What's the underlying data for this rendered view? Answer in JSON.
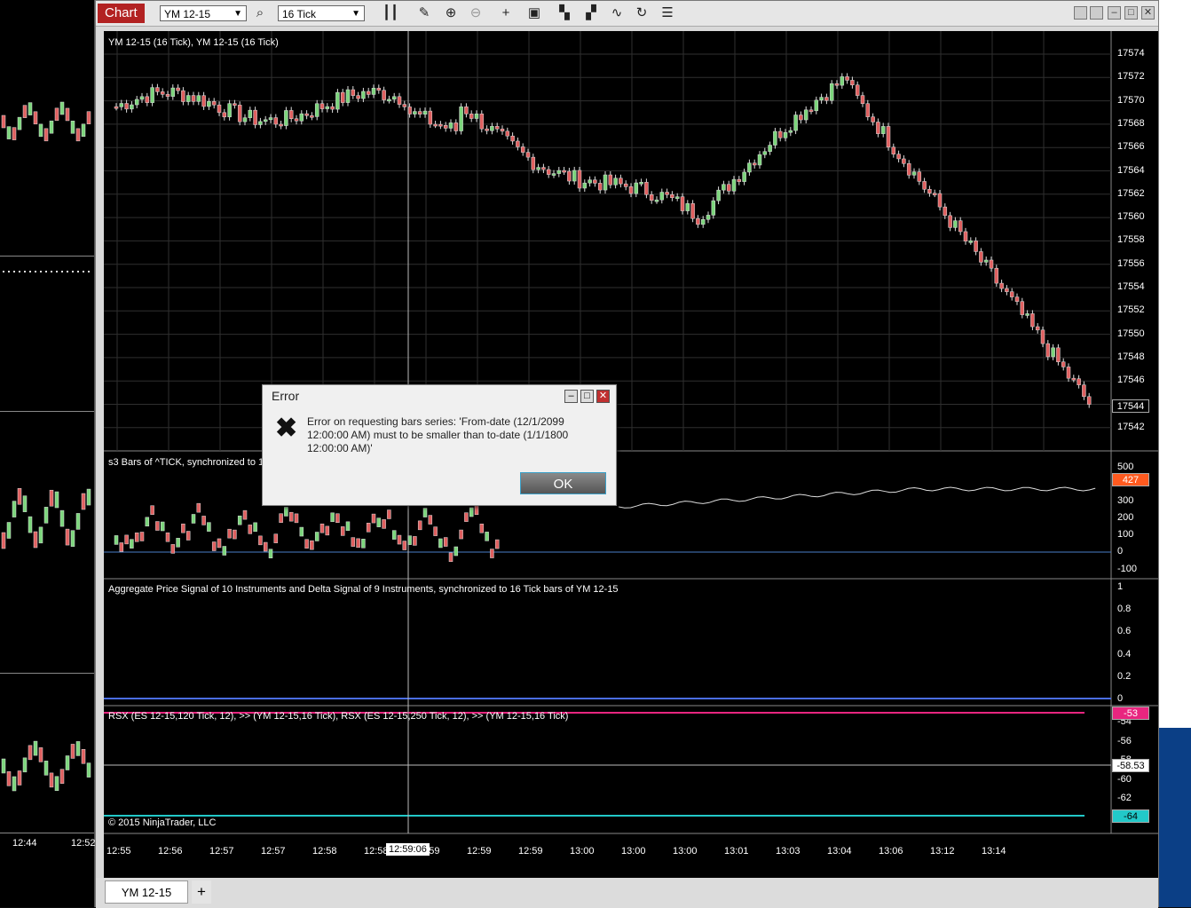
{
  "left_chart": {
    "times": [
      "12:44",
      "12:52"
    ]
  },
  "toolbar": {
    "chart_label": "Chart",
    "instrument": "YM 12-15",
    "interval": "16 Tick",
    "icons": [
      "search-icon",
      "bar-style-icon",
      "pencil-icon",
      "zoom-in-icon",
      "zoom-out-icon",
      "crosshair-icon",
      "data-box-icon",
      "strategy-icon",
      "indicator-icon",
      "trend-icon",
      "refresh-icon",
      "properties-icon"
    ]
  },
  "panels": {
    "price_title": "YM 12-15 (16 Tick), YM 12-15 (16 Tick)",
    "tick_title": "s3 Bars of ^TICK, synchronized to 16",
    "agg_title": "Aggregate Price Signal of 10 Instruments and Delta Signal of 9 Instruments, synchronized to 16 Tick bars of YM 12-15",
    "rsx_title": "RSX (ES 12-15,120 Tick, 12), >> (YM 12-15,16 Tick), RSX (ES 12-15,250 Tick, 12), >> (YM 12-15,16 Tick)",
    "copyright": "© 2015 NinjaTrader, LLC"
  },
  "price_axis": [
    "17574",
    "17572",
    "17570",
    "17568",
    "17566",
    "17564",
    "17562",
    "17560",
    "17558",
    "17556",
    "17554",
    "17552",
    "17550",
    "17548",
    "17546",
    "17544",
    "17542"
  ],
  "price_marker": "17544",
  "tick_axis": [
    "500",
    "300",
    "200",
    "100",
    "0",
    "-100"
  ],
  "tick_marker": "427",
  "agg_axis": [
    "1",
    "0.8",
    "0.6",
    "0.4",
    "0.2",
    "0"
  ],
  "rsx_axis": [
    "-54",
    "-56",
    "-58",
    "-60",
    "-62"
  ],
  "rsx_markers": {
    "top": "-53",
    "mid": "-58.53",
    "bottom": "-64"
  },
  "time_axis": [
    "12:55",
    "12:56",
    "12:57",
    "12:57",
    "12:58",
    "12:58",
    "12:59",
    "12:59",
    "12:59",
    "13:00",
    "13:00",
    "13:00",
    "13:01",
    "13:03",
    "13:04",
    "13:06",
    "13:12",
    "13:14"
  ],
  "crosshair_time": "12:59:06",
  "colors": {
    "up": "#7cd67c",
    "down": "#e06060",
    "accent": "#b22222",
    "rsx_magenta": "#e8257f",
    "rsx_cyan": "#22c8c8",
    "tick_marker": "#ff5a1f"
  },
  "tab": {
    "label": "YM 12-15",
    "add": "+"
  },
  "dialog": {
    "title": "Error",
    "message": "Error on requesting bars series: 'From-date (12/1/2099 12:00:00 AM) must to be smaller than to-date (1/1/1800 12:00:00 AM)'",
    "ok_label": "OK"
  }
}
